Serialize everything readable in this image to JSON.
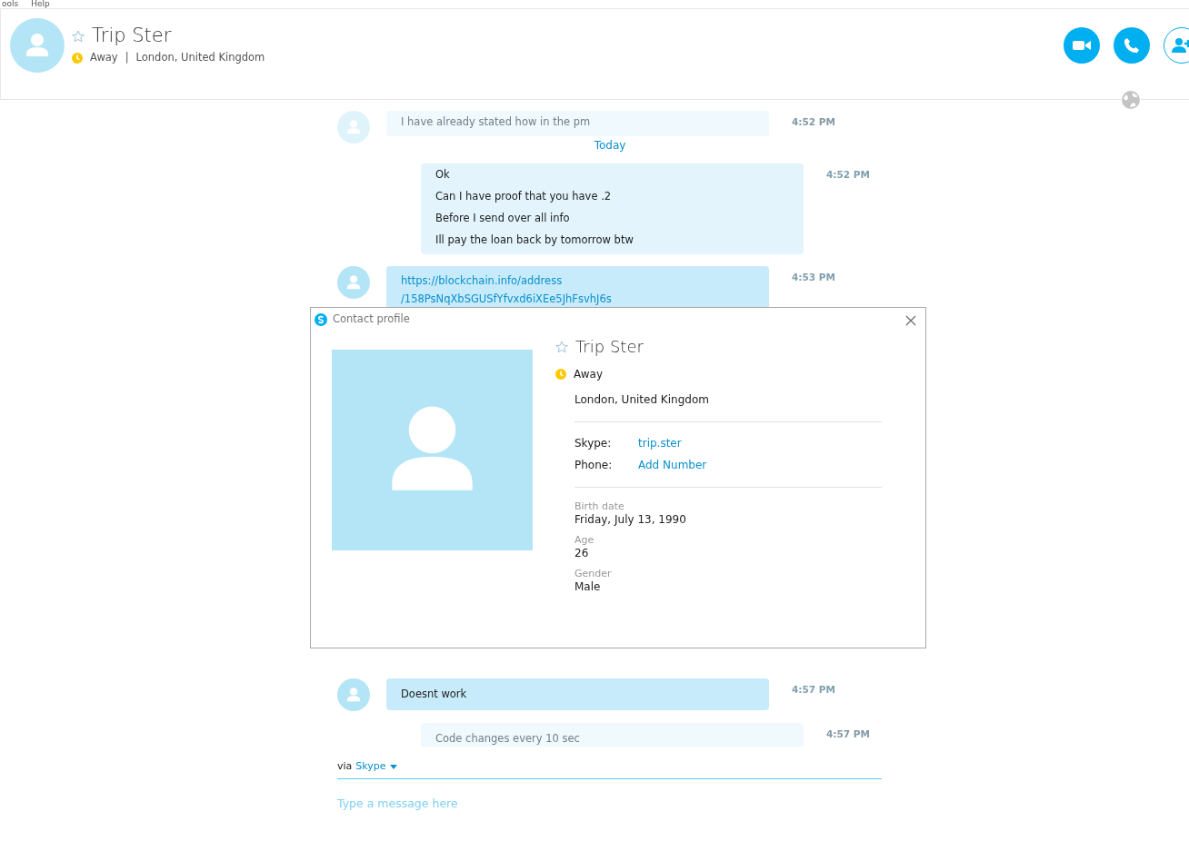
{
  "menu": [
    {
      "label": "ools"
    },
    {
      "label": "Help"
    }
  ],
  "header": {
    "name": "Trip Ster",
    "favorite": false,
    "status": "Away",
    "separator": "|",
    "location": "London, United Kingdom",
    "actions": [
      {
        "kind": "video"
      },
      {
        "kind": "call"
      },
      {
        "kind": "add"
      }
    ]
  },
  "messages": [
    {
      "kind": "incoming",
      "faded": true,
      "lines": [
        "I have already stated how in the pm"
      ],
      "time": "4:52 PM"
    },
    {
      "kind": "date",
      "text": "Today"
    },
    {
      "kind": "outgoing",
      "faded": false,
      "lines": [
        "Ok",
        "Can I have proof that you have .2",
        "Before I send over all info",
        "Ill pay the loan back by tomorrow btw"
      ],
      "time": "4:52 PM"
    },
    {
      "kind": "incoming",
      "faded": false,
      "link": true,
      "lines": [
        "https://blockchain.info/address",
        "/158PsNqXbSGUSfYfvxd6iXEe5JhFsvhJ6s"
      ],
      "time": "4:53 PM"
    },
    {
      "kind": "gap"
    },
    {
      "kind": "incoming",
      "faded": false,
      "lines": [
        "Doesnt work"
      ],
      "time": "4:57 PM"
    },
    {
      "kind": "outgoing",
      "faded": true,
      "lines": [
        "Code changes every 10 sec"
      ],
      "time": "4:57 PM"
    }
  ],
  "dialog": {
    "title": "Contact profile",
    "name": "Trip Ster",
    "favorite": false,
    "status": "Away",
    "location": "London, United Kingdom",
    "contacts": [
      {
        "label": "Skype:",
        "value": "trip.ster"
      },
      {
        "label": "Phone:",
        "value": "Add Number"
      }
    ],
    "details": [
      {
        "label": "Birth date",
        "value": "Friday, July 13, 1990"
      },
      {
        "label": "Age",
        "value": "26"
      },
      {
        "label": "Gender",
        "value": "Male"
      }
    ]
  },
  "compose": {
    "via": "via",
    "service": "Skype",
    "placeholder": "Type a message here"
  }
}
